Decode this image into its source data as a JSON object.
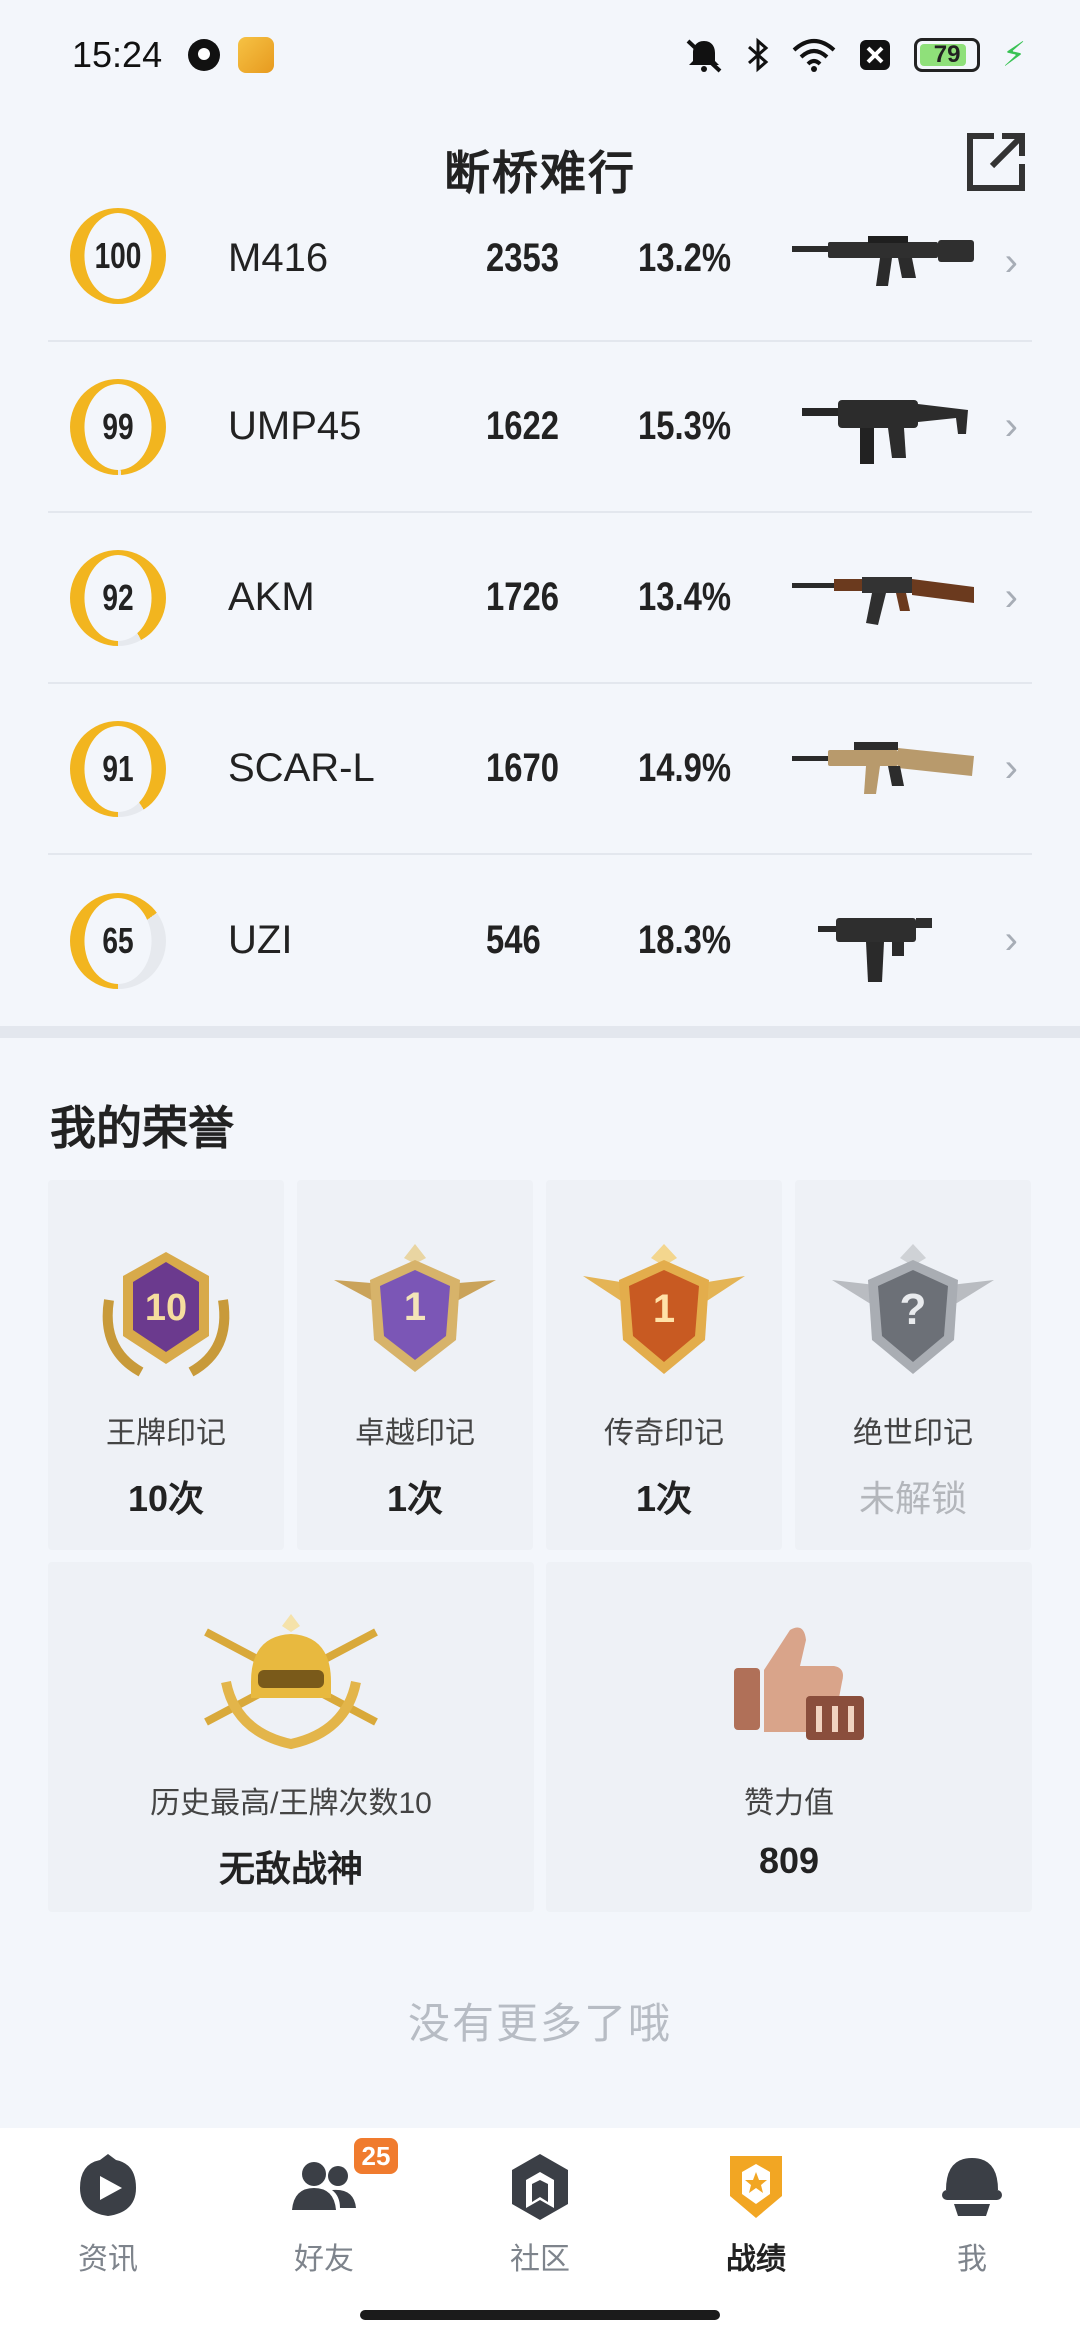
{
  "status_bar": {
    "time": "15:24",
    "battery": "79",
    "icons": [
      "app-icon",
      "bubble-icon",
      "mute-icon",
      "bluetooth-icon",
      "wifi-icon",
      "close-box-icon",
      "battery-icon",
      "charging-icon"
    ]
  },
  "header": {
    "title": "断桥难行",
    "share_icon": "share-icon"
  },
  "weapons": [
    {
      "score": "100",
      "score_pct": 100,
      "name": "M416",
      "kills": "2353",
      "rate": "13.2%",
      "icon": "rifle-m416"
    },
    {
      "score": "99",
      "score_pct": 99,
      "name": "UMP45",
      "kills": "1622",
      "rate": "15.3%",
      "icon": "smg-ump45"
    },
    {
      "score": "92",
      "score_pct": 92,
      "name": "AKM",
      "kills": "1726",
      "rate": "13.4%",
      "icon": "rifle-akm"
    },
    {
      "score": "91",
      "score_pct": 91,
      "name": "SCAR-L",
      "kills": "1670",
      "rate": "14.9%",
      "icon": "rifle-scarl"
    },
    {
      "score": "65",
      "score_pct": 65,
      "name": "UZI",
      "kills": "546",
      "rate": "18.3%",
      "icon": "smg-uzi"
    }
  ],
  "honors": {
    "title": "我的荣誉",
    "cards": [
      {
        "label": "王牌印记",
        "value": "10次",
        "badge_text": "10",
        "icon": "ace-badge-icon",
        "locked": false
      },
      {
        "label": "卓越印记",
        "value": "1次",
        "badge_text": "1",
        "icon": "excellence-badge-icon",
        "locked": false
      },
      {
        "label": "传奇印记",
        "value": "1次",
        "badge_text": "1",
        "icon": "legend-badge-icon",
        "locked": false
      },
      {
        "label": "绝世印记",
        "value": "未解锁",
        "badge_text": "?",
        "icon": "peerless-badge-icon",
        "locked": true
      }
    ],
    "wide_cards": [
      {
        "label": "历史最高/王牌次数10",
        "value": "无敌战神",
        "icon": "conqueror-helmet-icon"
      },
      {
        "label": "赞力值",
        "value": "809",
        "icon": "thumbs-up-icon"
      }
    ]
  },
  "end_text": "没有更多了哦",
  "colors": {
    "ring_accent": "#f2b51f",
    "ring_track": "#e6e9ee",
    "badge_orange": "#f07b2e"
  },
  "bottom_nav": [
    {
      "label": "资讯",
      "icon": "news-icon",
      "active": false
    },
    {
      "label": "好友",
      "icon": "friends-icon",
      "active": false,
      "badge": "25"
    },
    {
      "label": "社区",
      "icon": "community-icon",
      "active": false
    },
    {
      "label": "战绩",
      "icon": "record-icon",
      "active": true
    },
    {
      "label": "我",
      "icon": "profile-icon",
      "active": false
    }
  ]
}
